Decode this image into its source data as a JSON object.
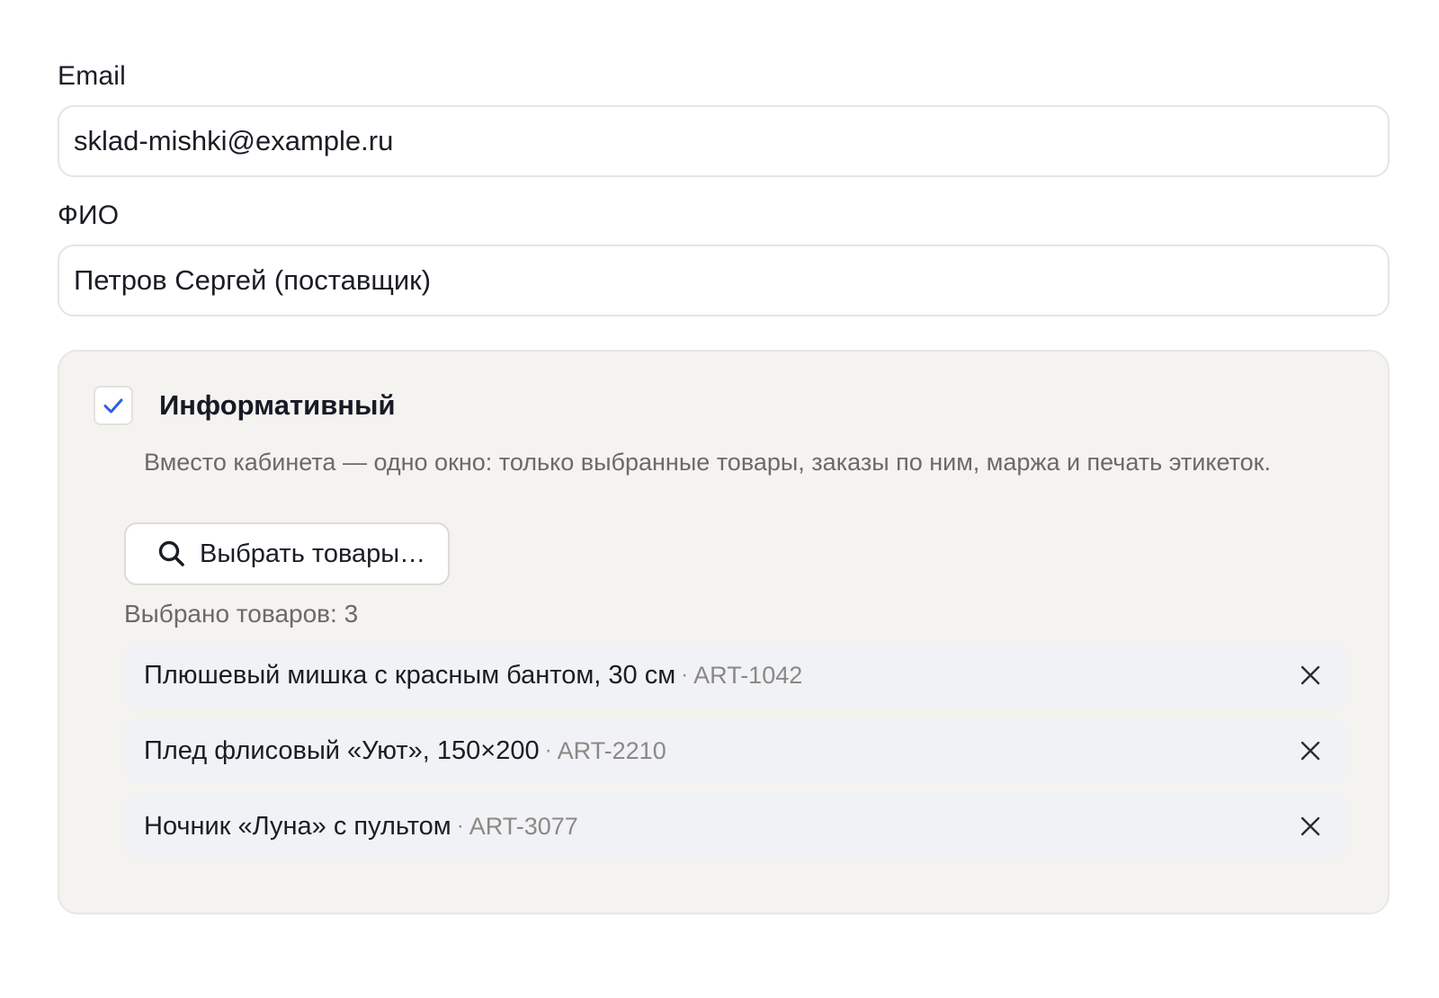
{
  "email": {
    "label": "Email",
    "value": "sklad-mishki@example.ru"
  },
  "fio": {
    "label": "ФИО",
    "value": "Петров Сергей (поставщик)"
  },
  "mode": {
    "checked": true,
    "title": "Информативный",
    "description": "Вместо кабинета — одно окно: только выбранные товары, заказы по ним, маржа и печать этикеток.",
    "select_button_label": "Выбрать товары…",
    "select_button_icon": "search-icon",
    "selected_count_text": "Выбрано товаров: 3",
    "items": [
      {
        "name": "Плюшевый мишка с красным бантом, 30 см",
        "separator": "·",
        "article": "ART-1042",
        "remove_icon": "close-icon"
      },
      {
        "name": "Плед флисовый «Уют», 150×200",
        "separator": "·",
        "article": "ART-2210",
        "remove_icon": "close-icon"
      },
      {
        "name": "Ночник «Луна» с пультом",
        "separator": "·",
        "article": "ART-3077",
        "remove_icon": "close-icon"
      }
    ]
  },
  "colors": {
    "accent": "#2f5fe0",
    "panel_bg": "#f4f3f0",
    "item_bg": "#f1f2f5",
    "muted_text": "#6b6a66"
  }
}
